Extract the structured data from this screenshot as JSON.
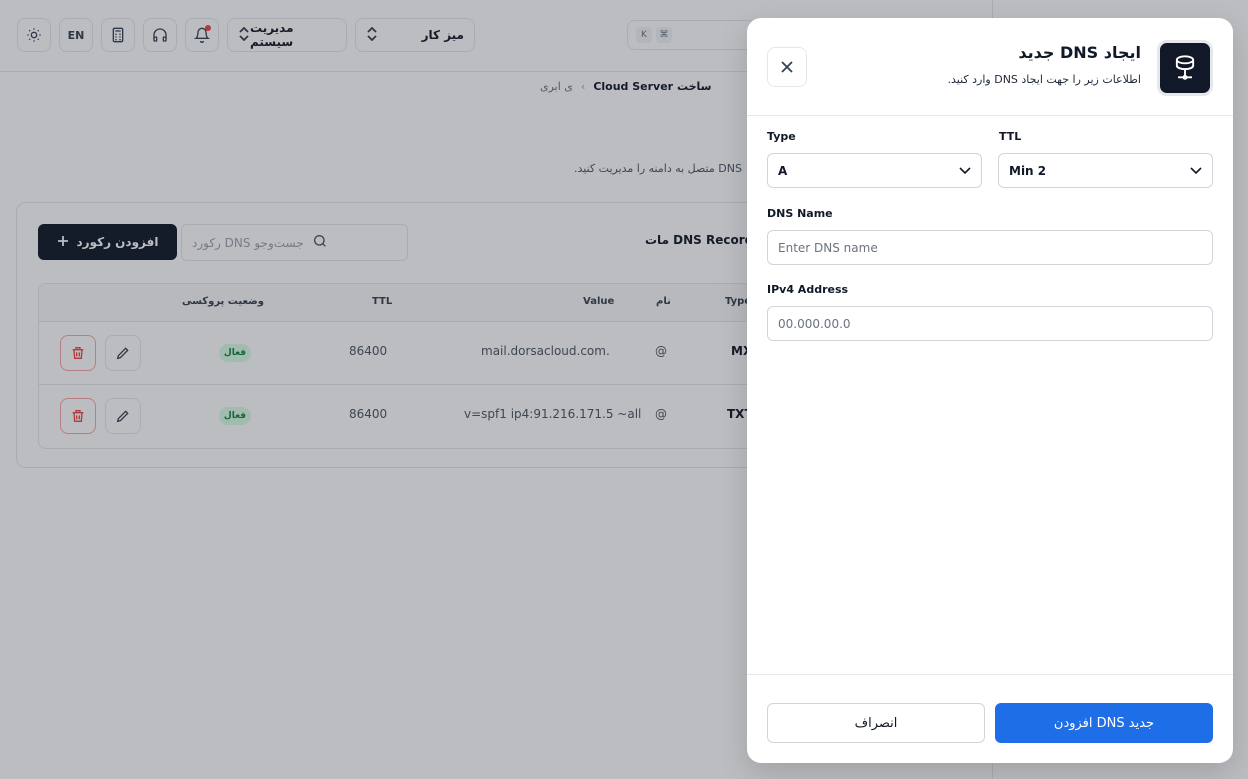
{
  "topbar": {
    "language": "EN",
    "system_select": "مدیریت سیستم",
    "workspace_select": "میز کار",
    "search_kbd_1": "K",
    "search_kbd_2": "⌘"
  },
  "breadcrumb": {
    "previous": "ی ابری",
    "current": "ساخت Cloud Server"
  },
  "page": {
    "description": "DNS متصل به دامنه را مدیریت کنید.",
    "card_title": "مات DNS Record",
    "add_record_label": "افزودن رکورد",
    "search_placeholder": "جست‌وجو DNS رکورد"
  },
  "table": {
    "headers": {
      "type": "Type",
      "name": "نام",
      "value": "Value",
      "ttl": "TTL",
      "proxy": "وضعیت پروکسی"
    },
    "rows": [
      {
        "type": "MX",
        "name": "@",
        "value": "mail.dorsacloud.com.",
        "ttl": "86400",
        "status": "فعال"
      },
      {
        "type": "TXT",
        "name": "@",
        "value": "v=spf1 ip4:91.216.171.5 ~all",
        "ttl": "86400",
        "status": "فعال"
      }
    ]
  },
  "modal": {
    "title": "ایجاد DNS جدید",
    "subtitle": "اطلاعات زیر را جهت ایجاد DNS وارد کنید.",
    "type_label": "Type",
    "type_value": "A",
    "ttl_label": "TTL",
    "ttl_value": "Min 2",
    "dns_name_label": "DNS Name",
    "dns_name_placeholder": "Enter DNS name",
    "ipv4_label": "IPv4 Address",
    "ipv4_placeholder": "00.000.00.0",
    "cancel_label": "انصراف",
    "submit_label": "افزودن DNS جدید"
  },
  "colors": {
    "primary": "#1e6ee8",
    "dark": "#111827",
    "active_badge_bg": "#dcfce7",
    "active_badge_text": "#15803d",
    "delete_red": "#ef4444"
  }
}
